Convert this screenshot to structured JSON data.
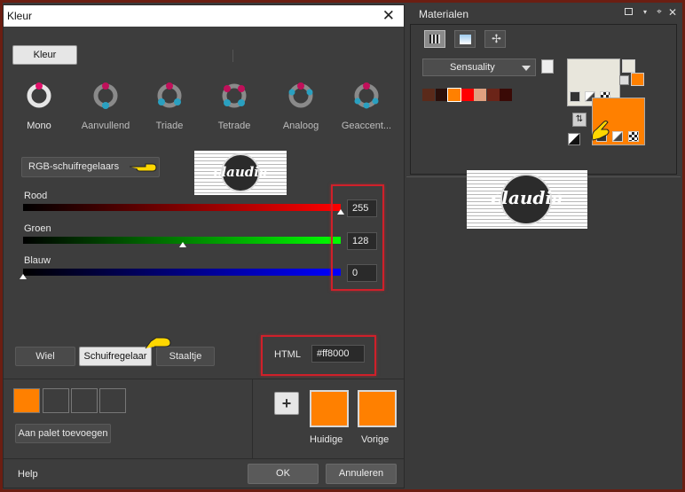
{
  "dialog": {
    "title": "Kleur",
    "tab_button": "Kleur",
    "modes": [
      {
        "label": "Mono",
        "icon": "mono-ring-icon"
      },
      {
        "label": "Aanvullend",
        "icon": "complementary-ring-icon"
      },
      {
        "label": "Triade",
        "icon": "triad-ring-icon"
      },
      {
        "label": "Tetrade",
        "icon": "tetrad-ring-icon"
      },
      {
        "label": "Analoog",
        "icon": "analogous-ring-icon"
      },
      {
        "label": "Geaccent...",
        "icon": "accented-ring-icon"
      }
    ],
    "slider_mode_button": "RGB-schuifregelaars",
    "watermark_text": "claudia",
    "sliders": [
      {
        "label": "Rood",
        "value": "255",
        "fraction": 1.0,
        "color": "#ff0000"
      },
      {
        "label": "Groen",
        "value": "128",
        "fraction": 0.502,
        "color": "#00ff00"
      },
      {
        "label": "Blauw",
        "value": "0",
        "fraction": 0.0,
        "color": "#0000ff"
      }
    ],
    "view_buttons": {
      "wheel": "Wiel",
      "sliders": "Schuifregelaar",
      "bars": "Staaltje"
    },
    "html_label": "HTML",
    "html_value": "#ff8000",
    "recent_swatches": [
      "#ff8000",
      "#3d3d3d",
      "#3d3d3d",
      "#3d3d3d"
    ],
    "add_palette_button": "Aan palet toevoegen",
    "add_icon": "plus-icon",
    "current_label": "Huidige",
    "previous_label": "Vorige",
    "current_color": "#ff8000",
    "previous_color": "#ff8000",
    "help": "Help",
    "ok": "OK",
    "cancel": "Annuleren"
  },
  "materials": {
    "title": "Materialen",
    "tab_icons": [
      "grid-icon",
      "gradient-icon",
      "tools-icon"
    ],
    "palette_name": "Sensuality",
    "palette_colors": [
      "#5a2a1a",
      "#2a0f0a",
      "#ff8000",
      "#ff0000",
      "#e0a080",
      "#6b2418",
      "#3a0a06"
    ],
    "foreground_color": "#e8e6dc",
    "background_color": "#ff8000",
    "watermark_text": "claudia"
  },
  "colors": {
    "highlight": "#d0202a",
    "orange": "#ff8000"
  }
}
